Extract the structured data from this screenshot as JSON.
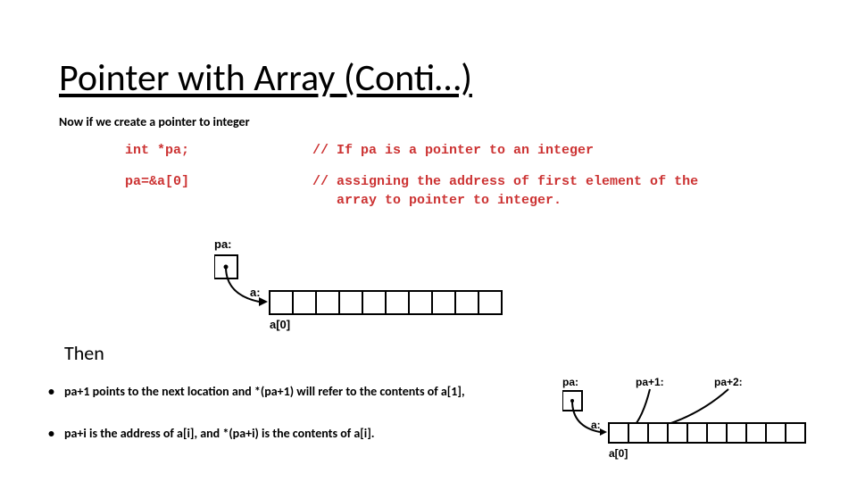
{
  "title": "Pointer with Array (Conti…)",
  "subtitle": "Now if we create a pointer to integer",
  "code": {
    "row1_left": "int *pa;",
    "row1_right": "// If pa is a pointer to an integer",
    "row2_left": "pa=&a[0]",
    "row2_right": "// assigning the address of first element of the\n   array to pointer to integer."
  },
  "then": "Then",
  "bullets": [
    "pa+1 points to the next location and *(pa+1) will refer to the contents of a[1],",
    "pa+i is the address of a[i], and *(pa+i) is the contents of a[i]."
  ],
  "diagram1": {
    "pa_label": "pa:",
    "a_label": "a:",
    "a0_label": "a[0]"
  },
  "diagram2": {
    "pa_label": "pa:",
    "pa1_label": "pa+1:",
    "pa2_label": "pa+2:",
    "a_label": "a:",
    "a0_label": "a[0]"
  }
}
